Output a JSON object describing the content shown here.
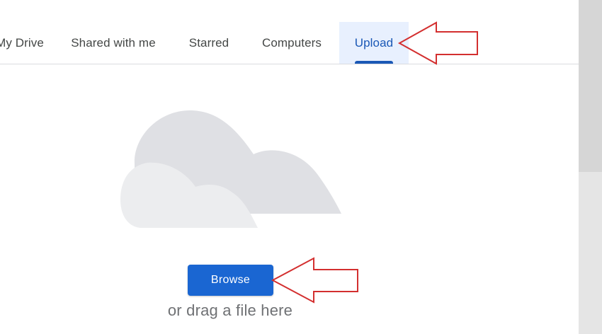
{
  "tabs": [
    {
      "label": "My Drive",
      "active": false
    },
    {
      "label": "Shared with me",
      "active": false
    },
    {
      "label": "Starred",
      "active": false
    },
    {
      "label": "Computers",
      "active": false
    },
    {
      "label": "Upload",
      "active": true
    }
  ],
  "upload": {
    "illustration_icon": "cloud-icon",
    "browse_label": "Browse",
    "drag_hint": "or drag a file here"
  },
  "colors": {
    "accent": "#1a58b6",
    "button": "#1a66d2",
    "active_tab_bg": "#e8f0fe",
    "annotation_arrow": "#d32f2f"
  }
}
